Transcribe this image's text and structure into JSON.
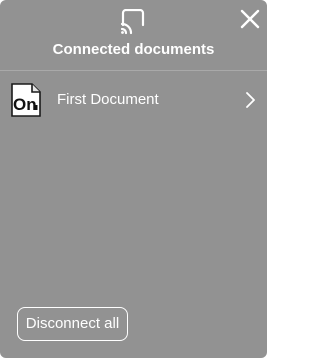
{
  "header": {
    "title": "Connected documents",
    "cast_icon": "cast-icon",
    "close_icon": "close-icon"
  },
  "documents": [
    {
      "label": "First Document",
      "icon": "onenote-document-icon",
      "chevron_icon": "chevron-right-icon"
    }
  ],
  "footer": {
    "disconnect_label": "Disconnect all"
  },
  "colors": {
    "panel_background": "#929292",
    "text": "#ffffff",
    "divider": "#a9a9a9"
  }
}
